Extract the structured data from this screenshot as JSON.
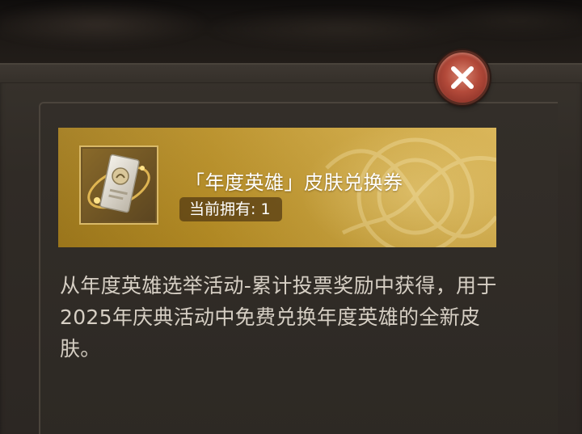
{
  "item": {
    "title": "「年度英雄」皮肤兑换券",
    "owned_label": "当前拥有:",
    "owned_count": "1",
    "icon": "skin-voucher-ticket-icon"
  },
  "description": "从年度英雄选举活动-累计投票奖励中获得，用于2025年庆典活动中免费兑换年度英雄的全新皮肤。",
  "close": {
    "icon": "close-icon"
  },
  "colors": {
    "card_gold": "#c29a32",
    "close_red": "#b34a3a",
    "text_light": "#d6cfc4"
  }
}
